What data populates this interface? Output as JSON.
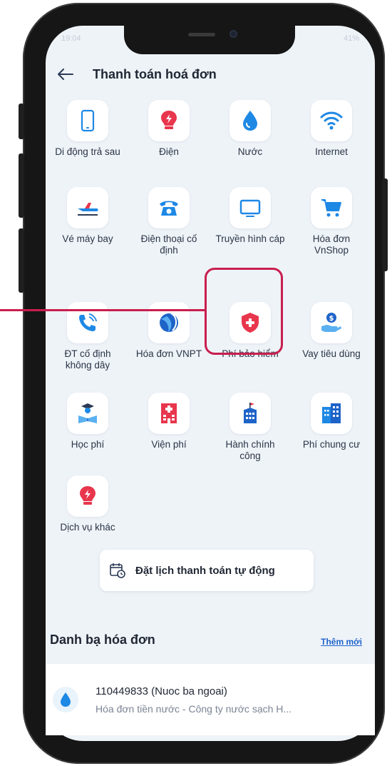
{
  "status_bar": {
    "time": "19:04",
    "indicators": "41%"
  },
  "header": {
    "title": "Thanh toán hoá đơn",
    "back_icon": "arrow-left-icon"
  },
  "services": [
    {
      "label": "Di động trả sau",
      "icon": "phone-icon"
    },
    {
      "label": "Điện",
      "icon": "bulb-icon"
    },
    {
      "label": "Nước",
      "icon": "water-drop-icon"
    },
    {
      "label": "Internet",
      "icon": "wifi-icon"
    },
    {
      "label": "Vé máy bay",
      "icon": "airplane-icon"
    },
    {
      "label": "Điện thoại cố định",
      "icon": "desk-phone-icon"
    },
    {
      "label": "Truyền hình cáp",
      "icon": "tv-icon"
    },
    {
      "label": "Hóa đơn VnShop",
      "icon": "cart-icon"
    },
    {
      "label": "ĐT cố định không dây",
      "icon": "phone-wireless-icon"
    },
    {
      "label": "Hóa đơn VNPT",
      "icon": "vnpt-icon"
    },
    {
      "label": "Phí bảo hiểm",
      "icon": "shield-plus-icon"
    },
    {
      "label": "Vay tiêu dùng",
      "icon": "coin-hand-icon"
    },
    {
      "label": "Học phí",
      "icon": "student-icon"
    },
    {
      "label": "Viện phí",
      "icon": "hospital-icon"
    },
    {
      "label": "Hành chính công",
      "icon": "government-icon"
    },
    {
      "label": "Phí chung cư",
      "icon": "apartment-icon"
    },
    {
      "label": "Dịch vụ khác",
      "icon": "bulb-icon"
    }
  ],
  "highlighted_service": "Phí bảo hiểm",
  "schedule_button": {
    "label": "Đặt lịch thanh toán tự động",
    "icon": "calendar-clock-icon"
  },
  "contacts": {
    "title": "Danh bạ hóa đơn",
    "add_label": "Thêm mới",
    "items": [
      {
        "name": "110449833 (Nuoc ba ngoai)",
        "description": "Hóa đơn tiền nước - Công ty nước sạch H...",
        "icon": "water-drop-icon"
      }
    ]
  },
  "colors": {
    "accent_red": "#e8364d",
    "accent_blue": "#1e88e5",
    "highlight": "#c81e4e",
    "background": "#eef3f8"
  }
}
